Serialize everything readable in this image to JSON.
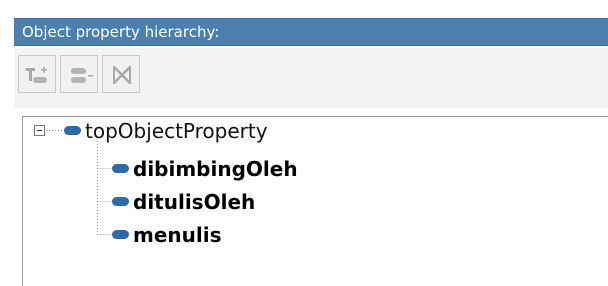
{
  "panel": {
    "title": "Object property hierarchy:"
  },
  "toolbar": {
    "buttons": [
      {
        "icon": "add-sub-property-icon"
      },
      {
        "icon": "add-sibling-property-icon"
      },
      {
        "icon": "delete-property-icon"
      }
    ]
  },
  "tree": {
    "root": {
      "label": "topObjectProperty",
      "expanded": true
    },
    "children": [
      {
        "label": "dibimbingOleh"
      },
      {
        "label": "ditulisOleh"
      },
      {
        "label": "menulis"
      }
    ]
  },
  "colors": {
    "title_bar": "#4a7fae",
    "property_icon": "#2e6aa8"
  }
}
